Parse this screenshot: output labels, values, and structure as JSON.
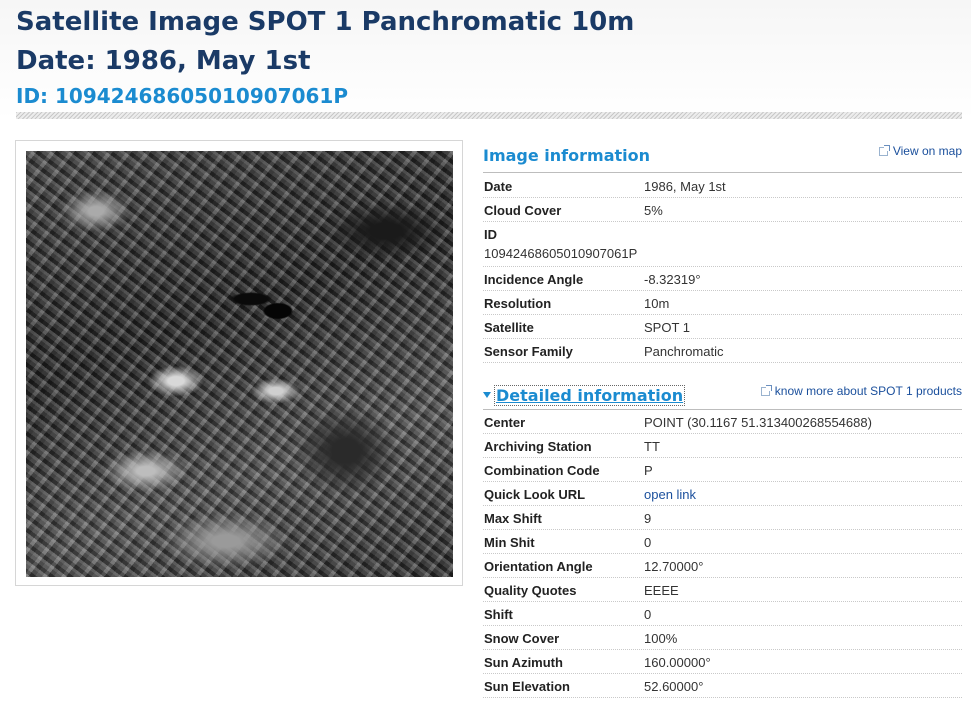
{
  "title": {
    "line1": "Satellite Image SPOT 1 Panchromatic 10m",
    "line2": "Date: 1986, May 1st",
    "id_line": "ID: 10942468605010907061P"
  },
  "image_section": {
    "heading": "Image information",
    "view_on_map": "View on map",
    "rows": [
      {
        "key": "Date",
        "value": "1986, May 1st"
      },
      {
        "key": "Cloud Cover",
        "value": "5%"
      },
      {
        "key": "ID",
        "value": "10942468605010907061P"
      },
      {
        "key": "Incidence Angle",
        "value": "-8.32319°"
      },
      {
        "key": "Resolution",
        "value": "10m"
      },
      {
        "key": "Satellite",
        "value": "SPOT 1"
      },
      {
        "key": "Sensor Family",
        "value": "Panchromatic"
      }
    ]
  },
  "detail_section": {
    "heading": "Detailed information",
    "know_more": "know more about SPOT 1 products",
    "rows": [
      {
        "key": "Center",
        "value": "POINT (30.1167 51.313400268554688)"
      },
      {
        "key": "Archiving Station",
        "value": "TT"
      },
      {
        "key": "Combination Code",
        "value": "P"
      },
      {
        "key": "Quick Look URL",
        "value": "open link"
      },
      {
        "key": "Max Shift",
        "value": "9"
      },
      {
        "key": "Min Shit",
        "value": "0"
      },
      {
        "key": "Orientation Angle",
        "value": "12.70000°"
      },
      {
        "key": "Quality Quotes",
        "value": "EEEE"
      },
      {
        "key": "Shift",
        "value": "0"
      },
      {
        "key": "Snow Cover",
        "value": "100%"
      },
      {
        "key": "Sun Azimuth",
        "value": "160.00000°"
      },
      {
        "key": "Sun Elevation",
        "value": "52.60000°"
      }
    ]
  },
  "colors": {
    "title": "#1a3a66",
    "accent": "#1b8bd0",
    "link": "#1a4f9c"
  }
}
